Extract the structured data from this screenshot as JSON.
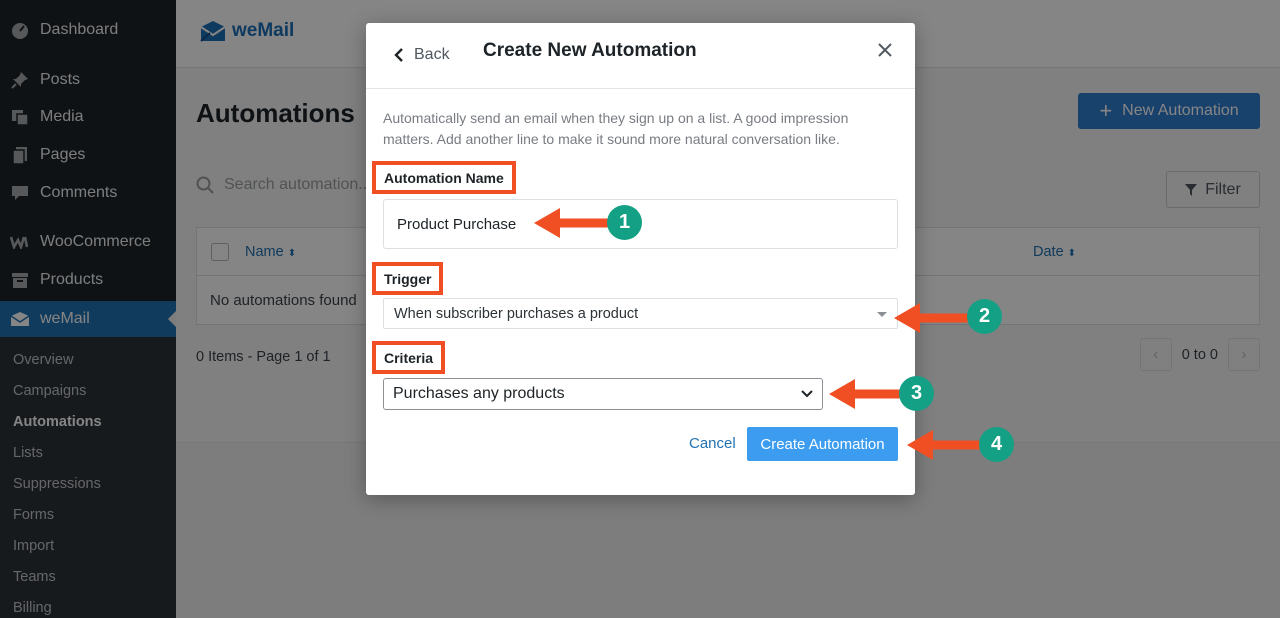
{
  "sidebar": {
    "menu": [
      {
        "label": "Dashboard",
        "icon": "dashboard-icon"
      },
      {
        "label": "Posts",
        "icon": "pin-icon"
      },
      {
        "label": "Media",
        "icon": "media-icon"
      },
      {
        "label": "Pages",
        "icon": "pages-icon"
      },
      {
        "label": "Comments",
        "icon": "comments-icon"
      },
      {
        "label": "WooCommerce",
        "icon": "woocommerce-icon"
      },
      {
        "label": "Products",
        "icon": "products-icon"
      },
      {
        "label": "weMail",
        "icon": "envelope-icon"
      }
    ],
    "submenu": [
      "Overview",
      "Campaigns",
      "Automations",
      "Lists",
      "Suppressions",
      "Forms",
      "Import",
      "Teams",
      "Billing"
    ]
  },
  "header": {
    "logo_text": "weMail"
  },
  "page": {
    "title": "Automations",
    "new_button": "New Automation",
    "search_placeholder": "Search automation...",
    "filter_label": "Filter",
    "columns": {
      "name": "Name",
      "date": "Date"
    },
    "empty_text": "No automations found",
    "items_info": "0 Items - Page 1 of 1",
    "range": "0 to 0"
  },
  "modal": {
    "back_label": "Back",
    "title": "Create New Automation",
    "description": "Automatically send an email when they sign up on a list. A good impression matters. Add another line to make it sound more natural conversation like.",
    "name_label": "Automation Name",
    "name_value": "Product Purchase",
    "trigger_label": "Trigger",
    "trigger_value": "When subscriber purchases a product",
    "criteria_label": "Criteria",
    "criteria_value": "Purchases any products",
    "cancel_label": "Cancel",
    "create_label": "Create Automation"
  },
  "annotations": {
    "steps": [
      "1",
      "2",
      "3",
      "4"
    ],
    "arrow_color": "#f04e23",
    "badge_color": "#14a085"
  },
  "colors": {
    "sidebar_bg": "#1d2327",
    "active_menu": "#2271b1",
    "primary_button": "#3b9cf0",
    "highlight_border": "#f04e23"
  }
}
